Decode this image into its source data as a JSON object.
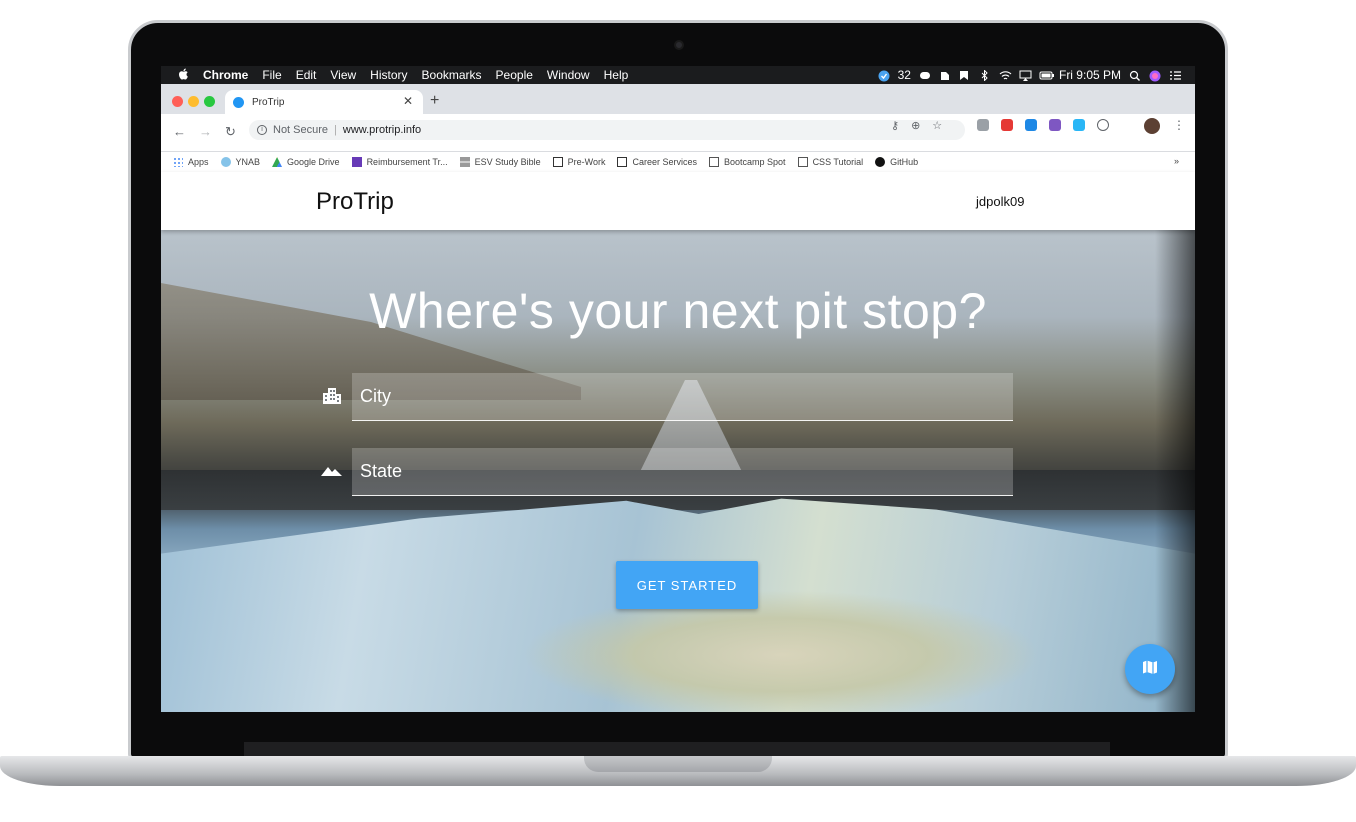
{
  "menubar": {
    "app": "Chrome",
    "items": [
      "File",
      "Edit",
      "View",
      "History",
      "Bookmarks",
      "People",
      "Window",
      "Help"
    ],
    "badge_count": "32",
    "clock": "Fri 9:05 PM"
  },
  "browser": {
    "tab_title": "ProTrip",
    "security_label": "Not Secure",
    "url": "www.protrip.info",
    "bookmarks": [
      "Apps",
      "YNAB",
      "Google Drive",
      "Reimbursement Tr...",
      "ESV Study Bible",
      "Pre-Work",
      "Career Services",
      "Bootcamp Spot",
      "CSS Tutorial",
      "GitHub"
    ],
    "bookmarks_overflow": "»"
  },
  "app": {
    "brand": "ProTrip",
    "username": "jdpolk09",
    "headline": "Where's your next pit stop?",
    "city_placeholder": "City",
    "state_placeholder": "State",
    "cta_label": "GET STARTED",
    "accent_color": "#42a5f5"
  },
  "icons": {
    "city_field": "city-buildings-icon",
    "state_field": "mountains-icon",
    "fab": "map-icon"
  }
}
